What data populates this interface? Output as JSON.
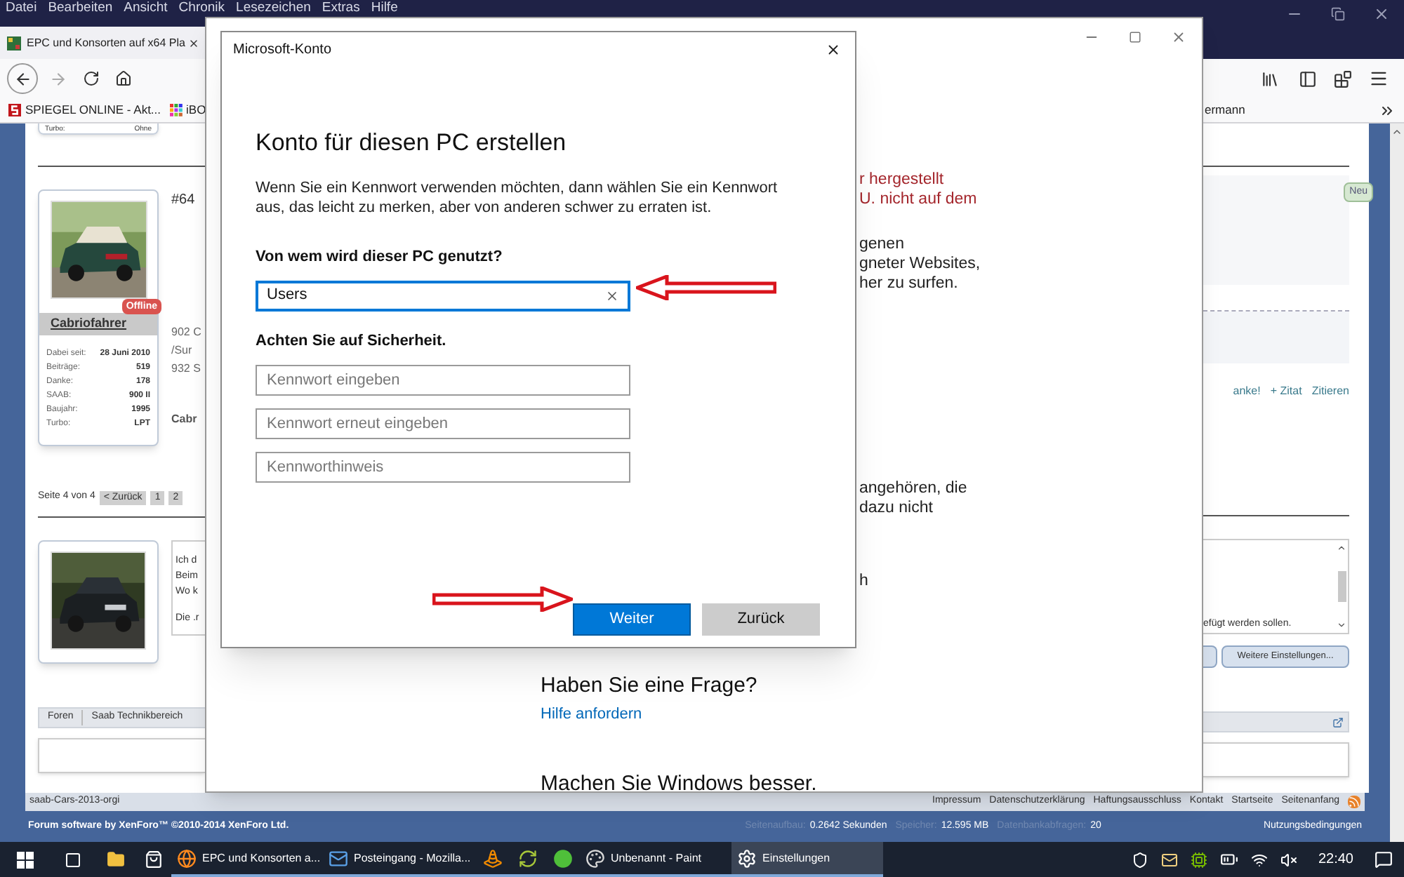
{
  "browser": {
    "menu": [
      "Datei",
      "Bearbeiten",
      "Ansicht",
      "Chronik",
      "Lesezeichen",
      "Extras",
      "Hilfe"
    ],
    "tab": {
      "title": "EPC und Konsorten auf x64 Pla"
    },
    "bookmarks": [
      {
        "label": "SPIEGEL ONLINE - Akt..."
      },
      {
        "label": "iBO"
      }
    ],
    "bookmark_cut": "ermann",
    "page": {
      "prev_card": {
        "label": "Turbo:",
        "value": "Ohne"
      },
      "post": {
        "number": "#64",
        "user": {
          "name": "Cabriofahrer",
          "status": "Offline",
          "stats": [
            {
              "label": "Dabei seit:",
              "value": "28 Juni 2010"
            },
            {
              "label": "Beiträge:",
              "value": "519"
            },
            {
              "label": "Danke:",
              "value": "178"
            },
            {
              "label": "SAAB:",
              "value": "900 II"
            },
            {
              "label": "Baujahr:",
              "value": "1995"
            },
            {
              "label": "Turbo:",
              "value": "LPT"
            }
          ]
        },
        "lines": [
          "902 C",
          "/Sur",
          "932 S"
        ],
        "signature": "Cabr"
      },
      "pagination": {
        "label": "Seite 4 von 4",
        "buttons": [
          "< Zurück",
          "1",
          "2"
        ]
      },
      "reply_lines": [
        "Ich d",
        "Beim",
        "Wo k",
        "Die .r"
      ],
      "new_badge": "Neu",
      "actions": [
        "anke!",
        "+ Zitat",
        "Zitieren"
      ],
      "editor_hint": "efügt werden sollen.",
      "more_button": "Weitere Einstellungen...",
      "breadcrumb": [
        "Foren",
        "Saab Technikbereich"
      ]
    },
    "footer": {
      "style": "saab-Cars-2013-orgi",
      "links": [
        "Impressum",
        "Datenschutzerklärung",
        "Haftungsausschluss",
        "Kontakt",
        "Startseite",
        "Seitenanfang"
      ],
      "copyright": "Forum software by XenForo™ ©2010-2014 XenForo Ltd.",
      "stats": [
        {
          "label": "Seitenaufbau:",
          "value": "0.2642 Sekunden"
        },
        {
          "label": "Speicher:",
          "value": "12.595 MB"
        },
        {
          "label": "Datenbankabfragen:",
          "value": "20"
        }
      ],
      "terms": "Nutzungsbedingungen"
    }
  },
  "settings_window": {
    "warning_lines": [
      "r hergestellt",
      "U. nicht auf dem"
    ],
    "text_lines_1": [
      "genen",
      "gneter Websites,",
      "her zu surfen."
    ],
    "text_lines_2": [
      "angehören, die",
      "dazu nicht"
    ],
    "text_lines_3": [
      "h"
    ],
    "help_heading": "Haben Sie eine Frage?",
    "help_link": "Hilfe anfordern",
    "feedback_heading": "Machen Sie Windows besser."
  },
  "dialog": {
    "title": "Microsoft-Konto",
    "heading": "Konto für diesen PC erstellen",
    "intro": "Wenn Sie ein Kennwort verwenden möchten, dann wählen Sie ein Kennwort aus, das leicht zu merken, aber von anderen schwer zu erraten ist.",
    "user_label": "Von wem wird dieser PC genutzt?",
    "user_field": {
      "value": "Users"
    },
    "security_label": "Achten Sie auf Sicherheit.",
    "password_fields": [
      {
        "placeholder": "Kennwort eingeben"
      },
      {
        "placeholder": "Kennwort erneut eingeben"
      },
      {
        "placeholder": "Kennworthinweis"
      }
    ],
    "primary_button": "Weiter",
    "secondary_button": "Zurück"
  },
  "taskbar": {
    "items": [
      {
        "label": "EPC und Konsorten a...",
        "selected": false
      },
      {
        "label": "Posteingang - Mozilla...",
        "selected": false
      },
      {
        "selected": false
      },
      {
        "selected": false
      },
      {
        "selected": false
      },
      {
        "label": "Unbenannt - Paint",
        "selected": false
      },
      {
        "label": "Einstellungen",
        "selected": true
      }
    ],
    "time": "22:40"
  }
}
